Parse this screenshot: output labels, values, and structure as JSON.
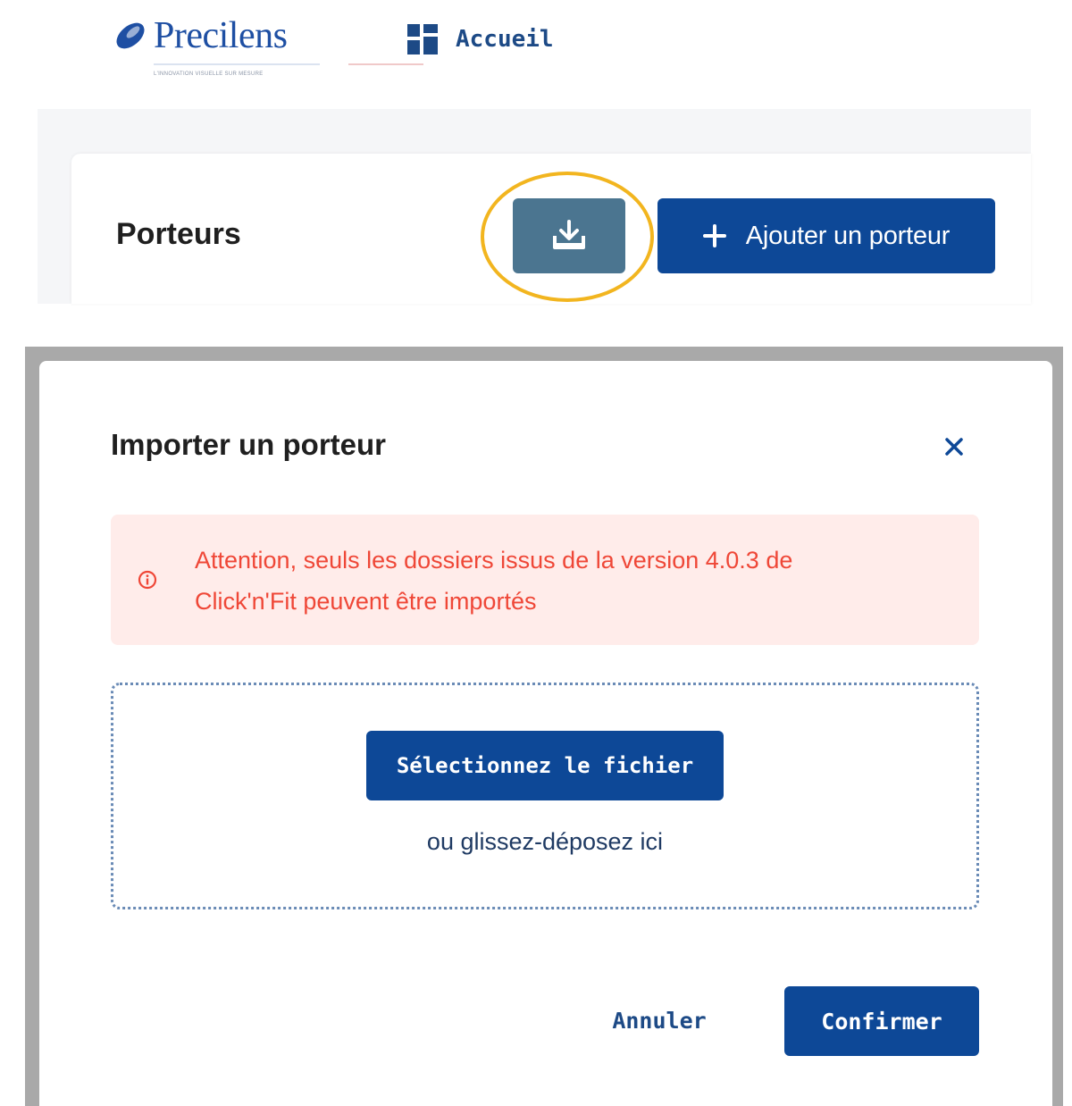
{
  "nav": {
    "logo_text": "Precilens",
    "logo_tagline": "L'innovation visuelle sur mesure",
    "home_label": "Accueil",
    "home_icon": "dashboard-grid-icon"
  },
  "header": {
    "title": "Porteurs",
    "import_icon": "download-tray-icon",
    "add_label": "Ajouter un porteur",
    "add_icon": "plus-icon"
  },
  "modal": {
    "title": "Importer un porteur",
    "close_icon": "close-icon",
    "alert": {
      "icon": "info-circle-icon",
      "line1": "Attention, seuls les dossiers issus de la version 4.0.3 de",
      "line2": "Click'n'Fit peuvent être importés"
    },
    "dropzone": {
      "select_label": "Sélectionnez le fichier",
      "hint": "ou glissez-déposez ici"
    },
    "cancel_label": "Annuler",
    "confirm_label": "Confirmer"
  },
  "colors": {
    "primary": "#0d4897",
    "import_button": "#4b7590",
    "highlight": "#f2b51f",
    "alert_bg": "#ffecea",
    "alert_text": "#ef4737",
    "overlay": "#a9a9a9"
  }
}
